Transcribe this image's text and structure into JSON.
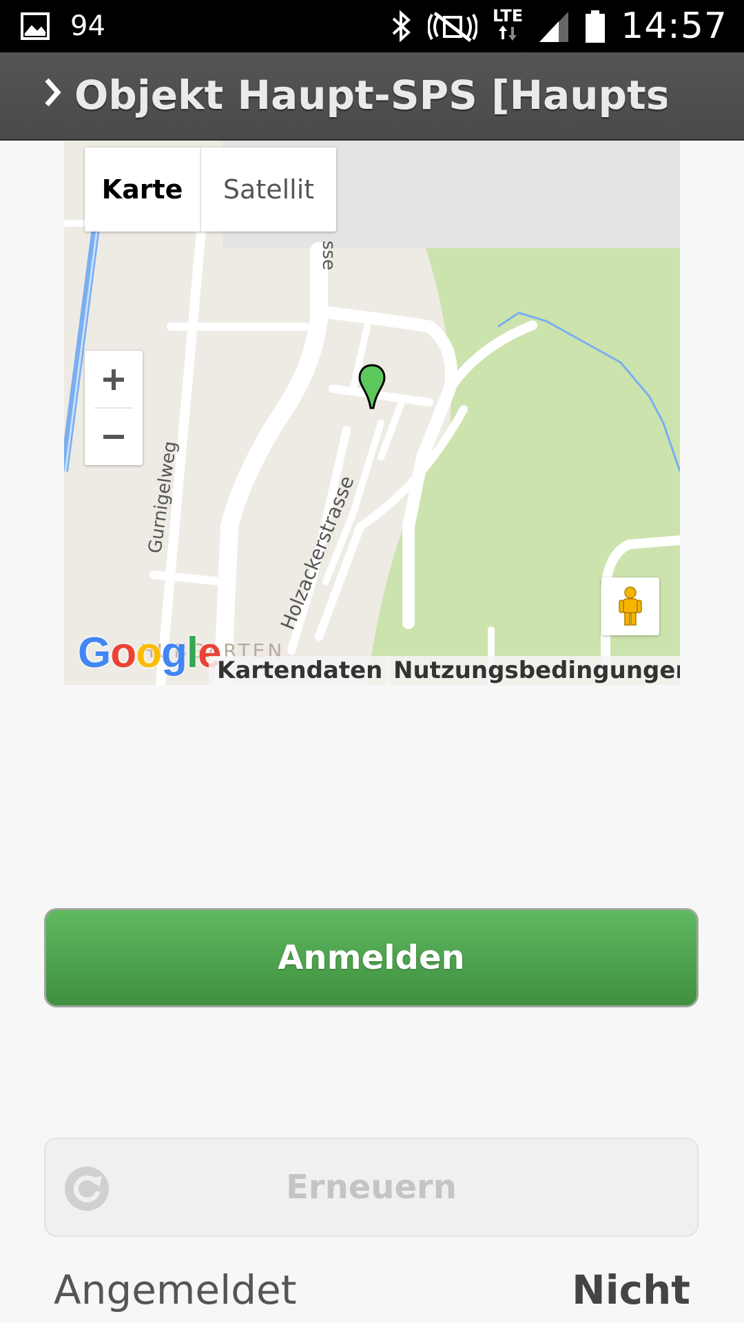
{
  "statusbar": {
    "notification_count": "94",
    "network_label": "LTE",
    "time": "14:57",
    "icons": [
      "image-icon",
      "bluetooth-icon",
      "mute-icon",
      "lte-icon",
      "signal-icon",
      "battery-icon"
    ]
  },
  "header": {
    "title": "Objekt Haupt-SPS [Hauptsteue",
    "chevron_icon": "chevron-right-icon"
  },
  "map": {
    "type_karte": "Karte",
    "type_satellit": "Satellit",
    "zoom_in": "+",
    "zoom_out": "−",
    "street_gurnigelweg": "Gurnigelweg",
    "street_holzacker": "Holzackerstrasse",
    "street_partial": "sse",
    "area_label": "HUBGARTEN",
    "google_logo": "Google",
    "attribution_data": "Kartendaten",
    "attribution_terms": "Nutzungsbedingungen",
    "colors": {
      "land": "#eeebe5",
      "park": "#cde3ad",
      "water": "#7aaef0",
      "marker": "#5cc85c"
    }
  },
  "buttons": {
    "login": "Anmelden",
    "refresh": "Erneuern"
  },
  "status": {
    "label": "Angemeldet",
    "value": "Nicht"
  }
}
